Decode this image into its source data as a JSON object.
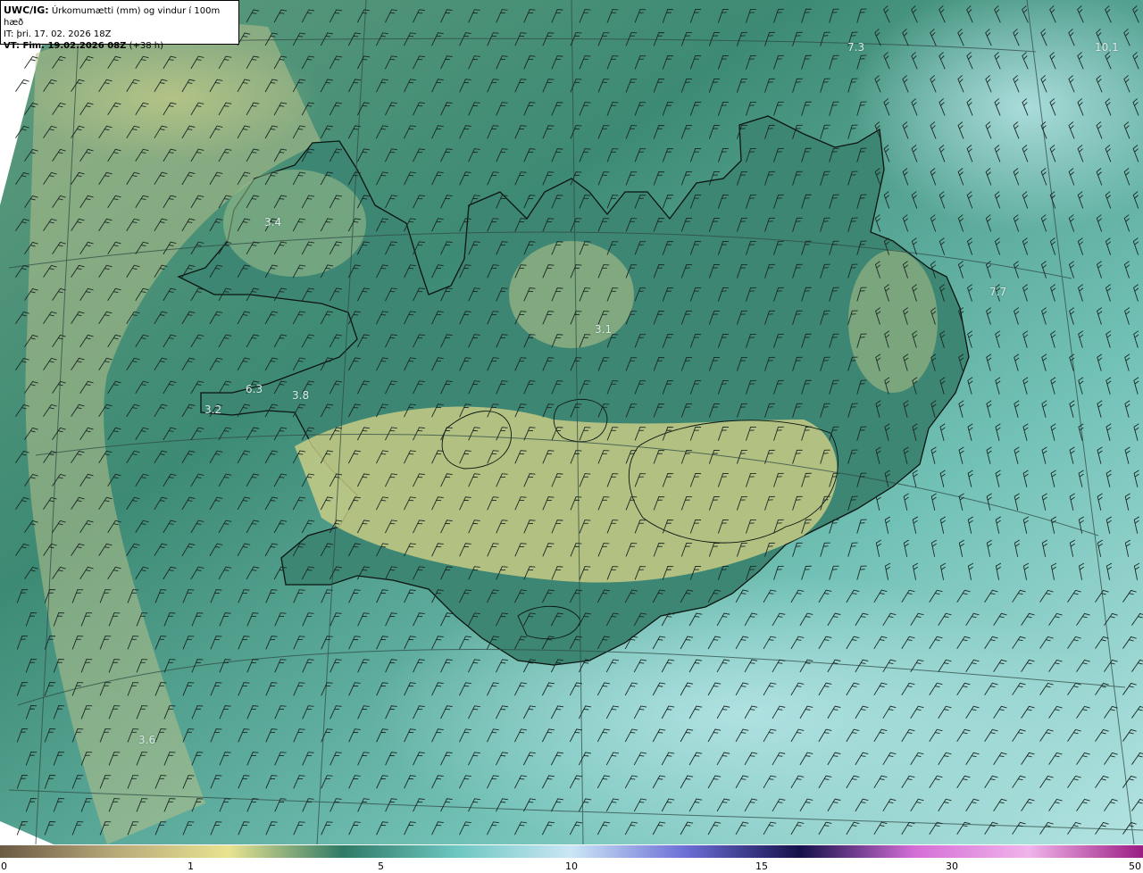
{
  "header": {
    "model_label": "UWC/IG:",
    "parameter": "Úrkomumætti (mm) og vindur í 100m hæð",
    "init_time": "IT: þri. 17. 02. 2026 18Z",
    "valid_label": "VT: Fim. 19.02.2026 08Z",
    "valid_offset": "(+38 h)"
  },
  "map_labels": [
    {
      "text": "3.4"
    },
    {
      "text": "3.1"
    },
    {
      "text": "6.3"
    },
    {
      "text": "3.8"
    },
    {
      "text": "3.2"
    },
    {
      "text": "3.6"
    },
    {
      "text": "7.3"
    },
    {
      "text": "10.1"
    },
    {
      "text": "7.7"
    }
  ],
  "colorbar": {
    "ticks": [
      "0",
      "1",
      "5",
      "10",
      "15",
      "30",
      "50"
    ],
    "colors": [
      "#6b5a44",
      "#b8a979",
      "#e9e391",
      "#2f7a66",
      "#6ec7c2",
      "#cbe6f6",
      "#6c6ed6",
      "#14104a",
      "#d46ed6",
      "#f0b4ea",
      "#9a1d83"
    ]
  },
  "palette": {
    "land_low": "#2f7262",
    "sea_high": "#a8dad6",
    "yellow": "#cfcf85",
    "coast": "#0a1410",
    "barb": "#1b2824"
  }
}
